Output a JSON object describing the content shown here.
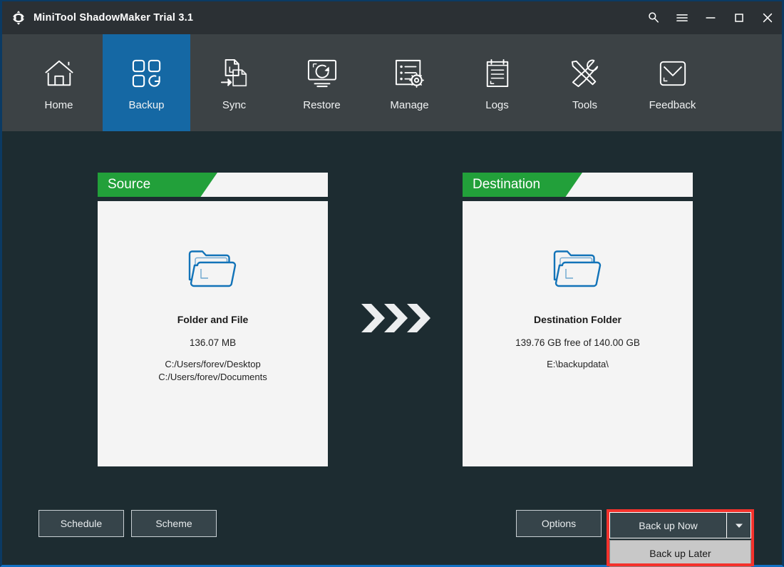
{
  "window": {
    "title": "MiniTool ShadowMaker Trial 3.1",
    "logo_icon": "shadowmaker-logo-icon",
    "controls": [
      {
        "name": "search-icon",
        "label": "Search"
      },
      {
        "name": "menu-icon",
        "label": "Menu"
      },
      {
        "name": "minimize-icon",
        "label": "Minimize"
      },
      {
        "name": "maximize-icon",
        "label": "Maximize"
      },
      {
        "name": "close-icon",
        "label": "Close"
      }
    ]
  },
  "nav": {
    "active": "Backup",
    "items": [
      {
        "label": "Home",
        "icon": "home-icon"
      },
      {
        "label": "Backup",
        "icon": "backup-grid-icon"
      },
      {
        "label": "Sync",
        "icon": "sync-files-icon"
      },
      {
        "label": "Restore",
        "icon": "restore-monitor-icon"
      },
      {
        "label": "Manage",
        "icon": "manage-list-gear-icon"
      },
      {
        "label": "Logs",
        "icon": "logs-clipboard-icon"
      },
      {
        "label": "Tools",
        "icon": "tools-wrench-screwdriver-icon"
      },
      {
        "label": "Feedback",
        "icon": "feedback-envelope-icon"
      }
    ]
  },
  "source_panel": {
    "tab_label": "Source",
    "icon": "folder-icon",
    "title": "Folder and File",
    "size": "136.07 MB",
    "path_line1": "C:/Users/forev/Desktop",
    "path_line2": "C:/Users/forev/Documents"
  },
  "destination_panel": {
    "tab_label": "Destination",
    "icon": "folder-icon",
    "title": "Destination Folder",
    "capacity": "139.76 GB free of 140.00 GB",
    "path": "E:\\backupdata\\"
  },
  "transfer_arrows": {
    "icon": "triple-chevron-right-icon",
    "count": 3
  },
  "actions": {
    "schedule": "Schedule",
    "scheme": "Scheme",
    "options": "Options",
    "backup_now": "Back up Now",
    "backup_later": "Back up Later",
    "dropdown_icon": "chevron-down-icon"
  },
  "colors": {
    "accent_blue": "#1568a4",
    "tab_green": "#22a03a",
    "panel_bg": "#f4f4f4",
    "app_bg": "#1d2c31",
    "navbar_bg": "#3c4245",
    "titlebar_bg": "#2b3034",
    "highlight_red": "#f4322c",
    "folder_blue": "#1273b8",
    "border_blue": "#1271c4"
  }
}
